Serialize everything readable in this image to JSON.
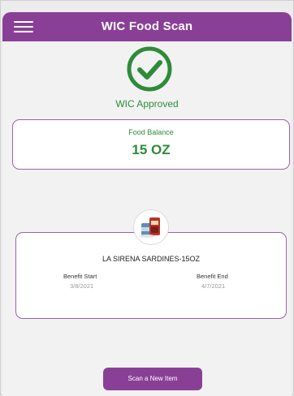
{
  "header": {
    "title": "WIC Food Scan",
    "menu_icon": "hamburger-menu-icon"
  },
  "status": {
    "icon": "check-circle-icon",
    "text": "WIC Approved"
  },
  "balance": {
    "label": "Food Balance",
    "value": "15 OZ"
  },
  "item": {
    "image": "sardine-can-product-icon",
    "name": "LA SIRENA SARDINES-15OZ",
    "benefit_start_label": "Benefit Start",
    "benefit_start_date": "3/8/2021",
    "benefit_end_label": "Benefit End",
    "benefit_end_date": "4/7/2021"
  },
  "actions": {
    "scan_new_label": "Scan a New Item"
  },
  "colors": {
    "brand_purple": "#8a3f97",
    "approved_green": "#2e8b3a",
    "card_border": "#9a62a6"
  }
}
